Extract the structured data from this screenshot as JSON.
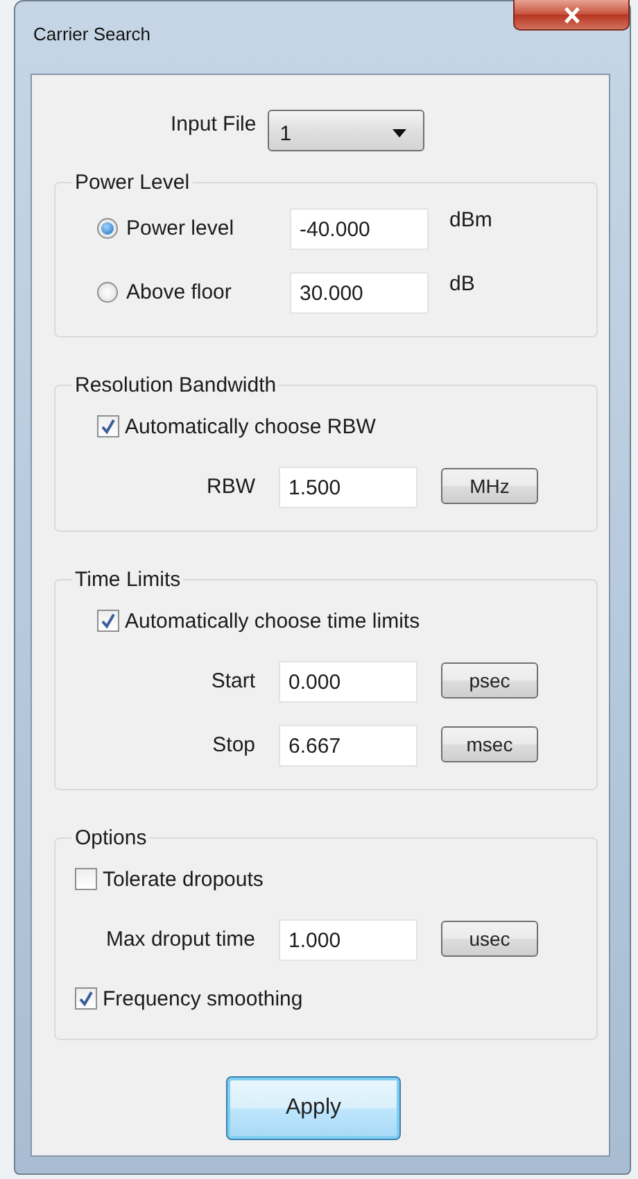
{
  "window": {
    "title": "Carrier Search"
  },
  "input_file": {
    "label": "Input File",
    "value": "1"
  },
  "sections": [
    {
      "title": "Power Level",
      "rows": [
        {
          "kind": "radio",
          "label": "Power level",
          "selected": true,
          "value": "-40.000",
          "unit": "dBm"
        },
        {
          "kind": "radio",
          "label": "Above floor",
          "selected": false,
          "value": "30.000",
          "unit": "dB"
        }
      ]
    },
    {
      "title": "Resolution Bandwidth",
      "rows": [
        {
          "kind": "check",
          "label": "Automatically choose RBW",
          "checked": true
        },
        {
          "kind": "field",
          "label": "RBW",
          "value": "1.500",
          "button": "MHz"
        }
      ]
    },
    {
      "title": "Time Limits",
      "rows": [
        {
          "kind": "check",
          "label": "Automatically choose time limits",
          "checked": true
        },
        {
          "kind": "field",
          "label": "Start",
          "value": "0.000",
          "button": "psec"
        },
        {
          "kind": "field",
          "label": "Stop",
          "value": "6.667",
          "button": "msec"
        }
      ]
    },
    {
      "title": "Options",
      "rows": [
        {
          "kind": "flush_check",
          "label": "Tolerate dropouts",
          "checked": false
        },
        {
          "kind": "field",
          "label": "Max droput time",
          "value": "1.000",
          "button": "usec"
        },
        {
          "kind": "flush_check",
          "label": "Frequency smoothing",
          "checked": true
        }
      ]
    }
  ],
  "apply": "Apply"
}
